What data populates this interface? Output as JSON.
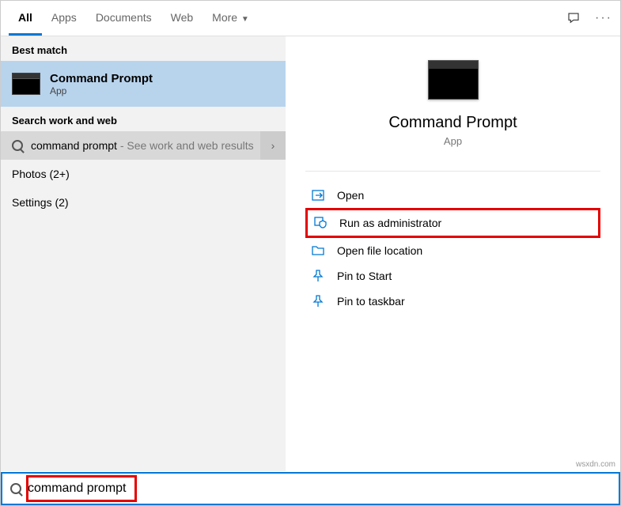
{
  "tabs": {
    "all": "All",
    "apps": "Apps",
    "documents": "Documents",
    "web": "Web",
    "more": "More"
  },
  "sections": {
    "best_match": "Best match",
    "search_work_web": "Search work and web"
  },
  "best_match_item": {
    "title": "Command Prompt",
    "subtitle": "App"
  },
  "web_result": {
    "query": "command prompt",
    "hint": " - See work and web results"
  },
  "categories": {
    "photos": "Photos (2+)",
    "settings": "Settings (2)"
  },
  "preview": {
    "title": "Command Prompt",
    "subtitle": "App"
  },
  "actions": {
    "open": "Open",
    "run_admin": "Run as administrator",
    "open_location": "Open file location",
    "pin_start": "Pin to Start",
    "pin_taskbar": "Pin to taskbar"
  },
  "search": {
    "value": "command prompt"
  },
  "watermark": "wsxdn.com"
}
